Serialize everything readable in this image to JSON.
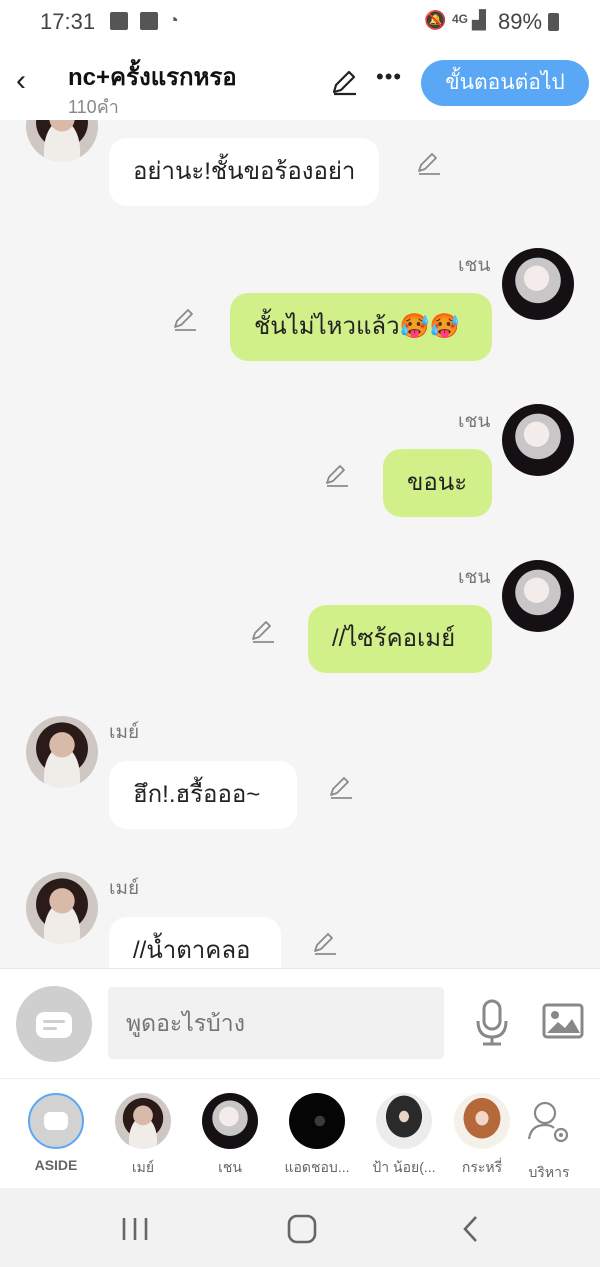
{
  "status_bar": {
    "time": "17:31",
    "network": "4G",
    "battery": "89%"
  },
  "header": {
    "title": "nc+ครั้งแรกหรอ",
    "word_count": "110คำ",
    "next_button": "ขั้นตอนต่อไป"
  },
  "messages": [
    {
      "side": "left",
      "name": "",
      "text": "อย่านะ!ชั้นขอร้องอย่า"
    },
    {
      "side": "right",
      "name": "เชน",
      "text": "ชั้นไม่ไหวแล้ว🥵🥵"
    },
    {
      "side": "right",
      "name": "เชน",
      "text": "ขอนะ"
    },
    {
      "side": "right",
      "name": "เชน",
      "text": "//ไซร้คอเมย์"
    },
    {
      "side": "left",
      "name": "เมย์",
      "text": "ฮึก!.ฮรื้อออ~"
    },
    {
      "side": "left",
      "name": "เมย์",
      "text": "//น้ำตาคลอ"
    }
  ],
  "input": {
    "placeholder": "พูดอะไรบ้าง"
  },
  "characters": [
    {
      "label": "ASIDE"
    },
    {
      "label": "เมย์"
    },
    {
      "label": "เชน"
    },
    {
      "label": "แอดชอบ..."
    },
    {
      "label": "ป้า น้อย(..."
    },
    {
      "label": "กระหรี่"
    },
    {
      "label": "บริหาร"
    }
  ],
  "colors": {
    "accent": "#5aa8f5",
    "my_bubble": "#d2f08a",
    "other_bubble": "#ffffff"
  }
}
